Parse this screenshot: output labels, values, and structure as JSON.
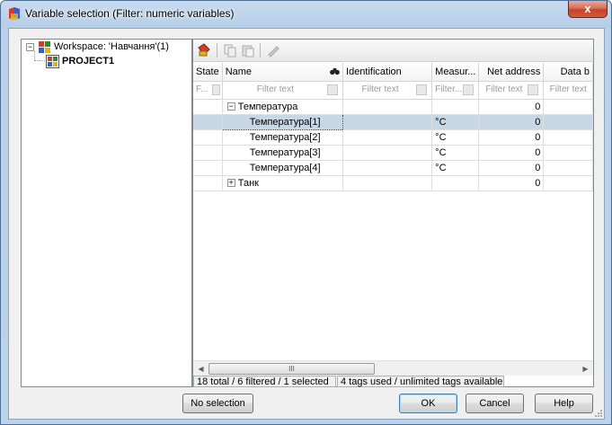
{
  "window": {
    "title": "Variable selection (Filter: numeric variables)",
    "close_label": "x"
  },
  "tree": {
    "workspace_label": "Workspace: 'Навчання'(1)",
    "project_label": "PROJECT1"
  },
  "grid": {
    "columns": [
      "State",
      "Name",
      "Identification",
      "Measur...",
      "Net address",
      "Data b"
    ],
    "filter_placeholders": [
      "F...",
      "Filter text",
      "Filter text",
      "Filter...",
      "Filter text",
      "Filter text"
    ],
    "rows": [
      {
        "type": "group",
        "expander": "−",
        "name": "Температура",
        "identification": "",
        "unit": "",
        "net_address": "0"
      },
      {
        "type": "child",
        "name": "Температура[1]",
        "identification": "",
        "unit": "°C",
        "net_address": "0",
        "selected": true
      },
      {
        "type": "child",
        "name": "Температура[2]",
        "identification": "",
        "unit": "°C",
        "net_address": "0"
      },
      {
        "type": "child",
        "name": "Температура[3]",
        "identification": "",
        "unit": "°C",
        "net_address": "0"
      },
      {
        "type": "child",
        "name": "Температура[4]",
        "identification": "",
        "unit": "°C",
        "net_address": "0"
      },
      {
        "type": "group",
        "expander": "+",
        "name": "Танк",
        "identification": "",
        "unit": "",
        "net_address": "0"
      }
    ],
    "scroll_thumb_label": "III"
  },
  "status": {
    "counts": "18 total / 6 filtered / 1 selected",
    "tags": "4 tags used / unlimited tags available"
  },
  "buttons": {
    "no_selection": "No selection",
    "ok": "OK",
    "cancel": "Cancel",
    "help": "Help"
  },
  "colors": {
    "selection": "#c7d7e5",
    "window_frame": "#b9d1ea",
    "close_button": "#c5432a"
  }
}
